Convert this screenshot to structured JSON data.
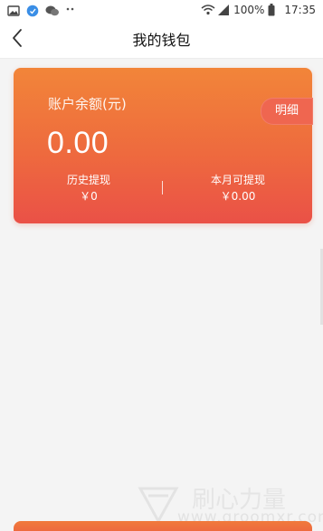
{
  "status_bar": {
    "left_icons": [
      "image-icon",
      "app-bubble-icon",
      "chat-icon",
      "more-dots-icon"
    ],
    "right_icons": [
      "wifi-icon",
      "signal-icon",
      "battery-icon"
    ],
    "battery": "100%",
    "time": "17:35"
  },
  "header": {
    "title": "我的钱包",
    "back_icon": "chevron-left-icon"
  },
  "wallet": {
    "balance_label": "账户余额(元)",
    "balance": "0.00",
    "details_label": "明细",
    "history_label": "历史提现",
    "history_value": "￥0",
    "month_label": "本月可提现",
    "month_value": "￥0.00"
  },
  "colors": {
    "card_top": "#f28539",
    "card_bottom": "#ea5147",
    "background": "#f4f4f4"
  }
}
